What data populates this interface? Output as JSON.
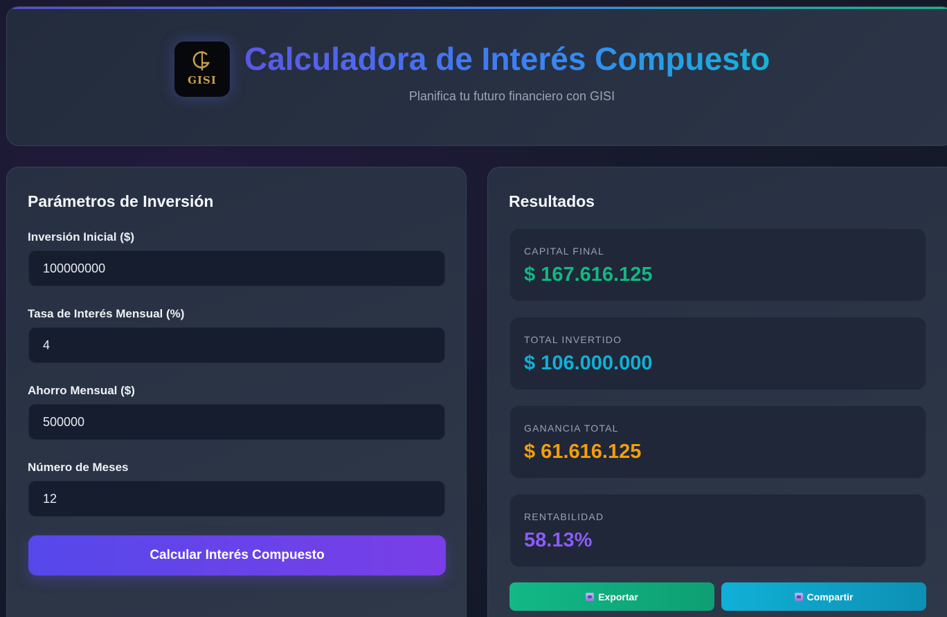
{
  "header": {
    "logo_text": "GISI",
    "title": "Calculadora de Interés Compuesto",
    "subtitle": "Planifica tu futuro financiero con GISI"
  },
  "params": {
    "title": "Parámetros de Inversión",
    "fields": [
      {
        "label": "Inversión Inicial ($)",
        "value": "100000000"
      },
      {
        "label": "Tasa de Interés Mensual (%)",
        "value": "4"
      },
      {
        "label": "Ahorro Mensual ($)",
        "value": "500000"
      },
      {
        "label": "Número de Meses",
        "value": "12"
      }
    ],
    "calculate_label": "Calcular Interés Compuesto"
  },
  "results": {
    "title": "Resultados",
    "cards": [
      {
        "label": "CAPITAL FINAL",
        "value": "$ 167.616.125",
        "color": "#10b981"
      },
      {
        "label": "TOTAL INVERTIDO",
        "value": "$ 106.000.000",
        "color": "#10b0d6"
      },
      {
        "label": "GANANCIA TOTAL",
        "value": "$ 61.616.125",
        "color": "#f59e0b"
      },
      {
        "label": "RENTABILIDAD",
        "value": "58.13%",
        "color": "#8b5cf6"
      }
    ],
    "export_label": "Exportar",
    "share_label": "Compartir"
  },
  "colors": {
    "accent": "#5548ea",
    "export": "#12b886",
    "share": "#10b0d6"
  }
}
